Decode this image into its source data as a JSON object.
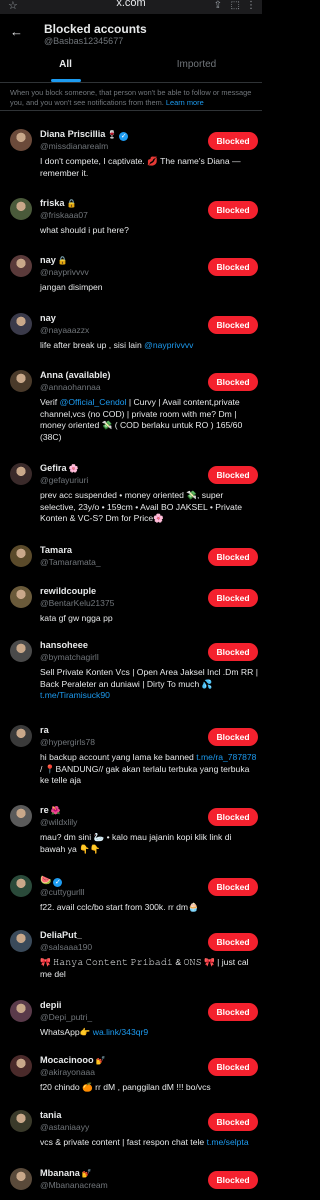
{
  "browser": {
    "url": "x.com"
  },
  "header": {
    "title": "Blocked accounts",
    "handle": "@Basbas12345677"
  },
  "tabs": [
    {
      "label": "All"
    },
    {
      "label": "Imported"
    }
  ],
  "notice": {
    "text": "When you block someone, that person won't be able to follow or message you, and you won't see notifications from them.",
    "link": "Learn more"
  },
  "button_label": "Blocked",
  "colors": {
    "accent": "#1d9bf0",
    "blocked": "#f4212e",
    "background": "#000000"
  },
  "accounts": [
    {
      "name": "Diana Priscillia",
      "name_emoji": "🍷",
      "verified": true,
      "locked": false,
      "handle": "@missdianarealm",
      "bio": [
        {
          "t": "I don't compete, I captivate. 💋 The name's Diana — remember it."
        }
      ]
    },
    {
      "name": "friska",
      "locked": true,
      "handle": "@friskaaa07",
      "bio": [
        {
          "t": "what should i put here?"
        }
      ]
    },
    {
      "name": "nay",
      "locked": true,
      "handle": "@nayprivvvv",
      "bio": [
        {
          "t": "jangan disimpen"
        }
      ]
    },
    {
      "name": "nay",
      "handle": "@nayaaazzx",
      "bio": [
        {
          "t": "life after break up , sisi lain "
        },
        {
          "t": "@nayprivvvv",
          "link": true
        }
      ]
    },
    {
      "name": "Anna (available)",
      "handle": "@annaohannaa",
      "bio": [
        {
          "t": "Verif "
        },
        {
          "t": "@Official_Cendol",
          "link": true
        },
        {
          "t": " | Curvy | Avail content,private channel,vcs (no COD) | private room with me? Dm | money oriented 💸 ( COD berlaku untuk RO ) 165/60 (38C)"
        }
      ]
    },
    {
      "name": "Gefira",
      "name_emoji": "🌸",
      "handle": "@gefayuriuri",
      "bio": [
        {
          "t": "prev acc suspended • money oriented 💸, super selective, 23y/o • 159cm • Avail BO JAKSEL • Private Konten & VC-S? Dm for Price🌸"
        }
      ]
    },
    {
      "name": "Tamara",
      "handle": "@Tamaramata_",
      "bio": []
    },
    {
      "name": "rewildcouple",
      "handle": "@BentarKelu21375",
      "bio": [
        {
          "t": "kata gf gw ngga pp"
        }
      ]
    },
    {
      "name": "hansoheee",
      "handle": "@bymatchagirll",
      "bio": [
        {
          "t": "Sell Private Konten Vcs | Open Area Jaksel Incl .Dm RR | Back Peraleter an duniawi | Dirty To much 💦 "
        },
        {
          "t": "t.me/Tiramisuck90",
          "link": true
        }
      ]
    },
    {
      "name": "ra",
      "handle": "@hypergirls78",
      "bio": [
        {
          "t": "hi backup account yang lama ke banned "
        },
        {
          "t": "t.me/ra_787878",
          "link": true
        },
        {
          "t": " / 📍BANDUNG// gak akan terlalu terbuka yang terbuka ke telle aja"
        }
      ]
    },
    {
      "name": "re",
      "name_emoji": "🌺",
      "handle": "@wildxlily",
      "bio": [
        {
          "t": "mau? dm sini 🦢 • kalo mau jajanin kopi klik link di bawah ya 👇👇"
        }
      ]
    },
    {
      "name": "🍉",
      "verified": true,
      "handle": "@cuttygurlll",
      "bio": [
        {
          "t": "f22. avail cclc/bo start from 300k. rr dm🧁"
        }
      ]
    },
    {
      "name": "DeliaPut_",
      "handle": "@salsaaa190",
      "bio": [
        {
          "t": "🎀 𝙷𝚊𝚗𝚢𝚊 𝙲𝚘𝚗𝚝𝚎𝚗𝚝 𝙿𝚛𝚒𝚋𝚊𝚍𝚒 & 𝙾𝙽𝚂 🎀 | just cal me del"
        }
      ]
    },
    {
      "name": "depii",
      "handle": "@Depi_putri_",
      "bio": [
        {
          "t": "WhatsApp👉 "
        },
        {
          "t": "wa.link/343qr9",
          "link": true
        }
      ]
    },
    {
      "name": "Mocacinooo",
      "name_emoji": "💅",
      "handle": "@akirayonaaa",
      "bio": [
        {
          "t": "f20 chindo 🍊 rr dM , panggilan dM !!! bo/vcs"
        }
      ]
    },
    {
      "name": "tania",
      "handle": "@astaniaayy",
      "bio": [
        {
          "t": "vcs & private content | fast respon chat tele "
        },
        {
          "t": "t.me/selpta",
          "link": true
        }
      ]
    },
    {
      "name": "Mbanana",
      "name_emoji": "💅",
      "handle": "@Mbananacream",
      "bio": []
    }
  ]
}
